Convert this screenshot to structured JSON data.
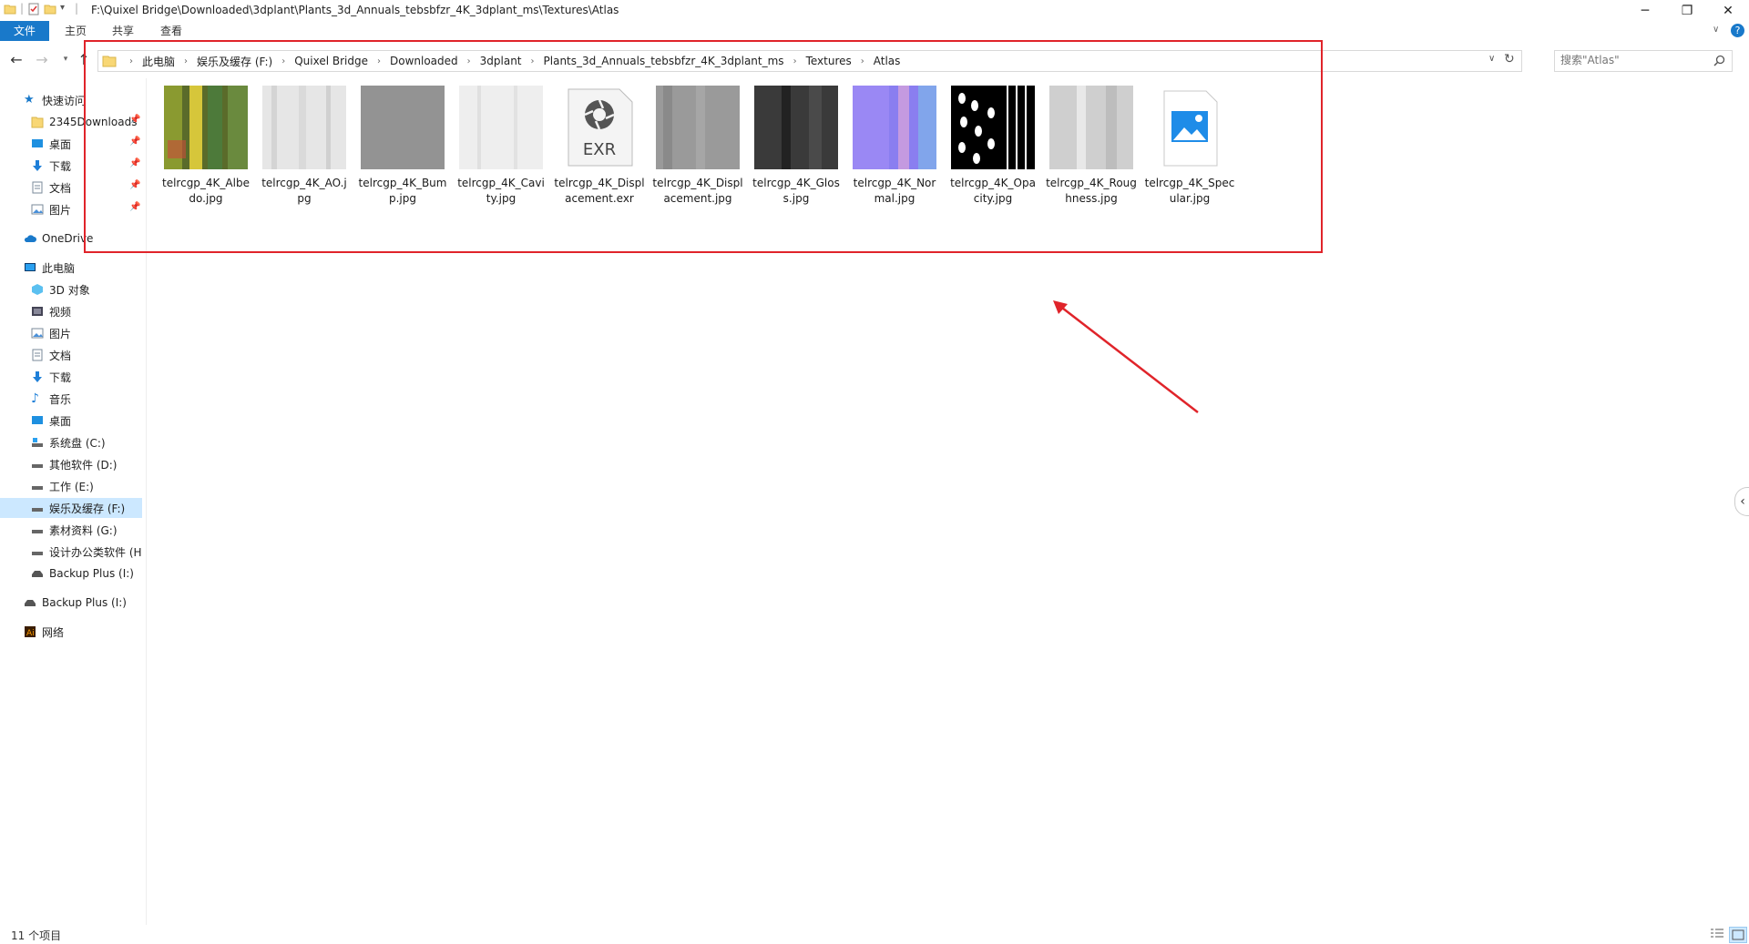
{
  "window": {
    "path": "F:\\Quixel Bridge\\Downloaded\\3dplant\\Plants_3d_Annuals_tebsbfzr_4K_3dplant_ms\\Textures\\Atlas",
    "minimize_icon": "minimize-icon",
    "maximize_icon": "restore-icon",
    "close_icon": "close-icon"
  },
  "ribbon": {
    "tabs": [
      "文件",
      "主页",
      "共享",
      "查看"
    ],
    "help_icon": "help-icon"
  },
  "address": {
    "crumbs": [
      "此电脑",
      "娱乐及缓存 (F:)",
      "Quixel Bridge",
      "Downloaded",
      "3dplant",
      "Plants_3d_Annuals_tebsbfzr_4K_3dplant_ms",
      "Textures",
      "Atlas"
    ]
  },
  "search": {
    "placeholder": "搜索\"Atlas\""
  },
  "sidebar": {
    "quick_access": "快速访问",
    "quick_items": [
      {
        "label": "2345Downloads",
        "icon": "folder-icon"
      },
      {
        "label": "桌面",
        "icon": "desktop-icon"
      },
      {
        "label": "下载",
        "icon": "download-icon"
      },
      {
        "label": "文档",
        "icon": "document-icon"
      },
      {
        "label": "图片",
        "icon": "pictures-icon"
      }
    ],
    "onedrive": "OneDrive",
    "this_pc": "此电脑",
    "pc_items": [
      {
        "label": "3D 对象",
        "icon": "3d-objects-icon"
      },
      {
        "label": "视频",
        "icon": "video-icon"
      },
      {
        "label": "图片",
        "icon": "pictures-icon"
      },
      {
        "label": "文档",
        "icon": "document-icon"
      },
      {
        "label": "下载",
        "icon": "download-icon"
      },
      {
        "label": "音乐",
        "icon": "music-icon"
      },
      {
        "label": "桌面",
        "icon": "desktop-icon"
      },
      {
        "label": "系统盘 (C:)",
        "icon": "system-drive-icon"
      },
      {
        "label": "其他软件 (D:)",
        "icon": "drive-icon"
      },
      {
        "label": "工作 (E:)",
        "icon": "drive-icon"
      },
      {
        "label": "娱乐及缓存 (F:)",
        "icon": "drive-icon"
      },
      {
        "label": "素材资料 (G:)",
        "icon": "drive-icon"
      },
      {
        "label": "设计办公类软件 (H:",
        "icon": "drive-icon"
      },
      {
        "label": "Backup Plus (I:)",
        "icon": "external-drive-icon"
      }
    ],
    "backup": "Backup Plus (I:)",
    "network": "网络"
  },
  "files": [
    {
      "name": "telrcgp_4K_Albedo.jpg",
      "icon": "image-thumbnail"
    },
    {
      "name": "telrcgp_4K_AO.jpg",
      "icon": "image-thumbnail"
    },
    {
      "name": "telrcgp_4K_Bump.jpg",
      "icon": "image-thumbnail"
    },
    {
      "name": "telrcgp_4K_Cavity.jpg",
      "icon": "image-thumbnail"
    },
    {
      "name": "telrcgp_4K_Displacement.exr",
      "icon": "exr-file-icon",
      "badge": "EXR"
    },
    {
      "name": "telrcgp_4K_Displacement.jpg",
      "icon": "image-thumbnail"
    },
    {
      "name": "telrcgp_4K_Gloss.jpg",
      "icon": "image-thumbnail"
    },
    {
      "name": "telrcgp_4K_Normal.jpg",
      "icon": "image-thumbnail"
    },
    {
      "name": "telrcgp_4K_Opacity.jpg",
      "icon": "image-thumbnail"
    },
    {
      "name": "telrcgp_4K_Roughness.jpg",
      "icon": "image-thumbnail"
    },
    {
      "name": "telrcgp_4K_Specular.jpg",
      "icon": "image-file-icon"
    }
  ],
  "status": {
    "count": "11 个项目"
  },
  "colors": {
    "accent": "#1979ca",
    "highlight_box": "#e0242a",
    "selected": "#cce8ff"
  }
}
